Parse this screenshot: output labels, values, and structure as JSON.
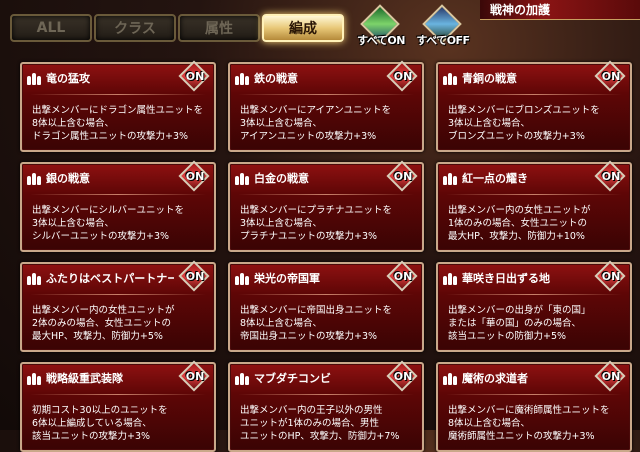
{
  "tabs": [
    {
      "label": "ALL",
      "active": false
    },
    {
      "label": "クラス",
      "active": false
    },
    {
      "label": "属性",
      "active": false
    },
    {
      "label": "編成",
      "active": true
    }
  ],
  "toggles": {
    "all_on": "すべてON",
    "all_off": "すべてOFF"
  },
  "banner": {
    "title": "戦神の加護"
  },
  "badge_label": "ON",
  "cards": [
    {
      "title": "竜の猛攻",
      "desc": "出撃メンバーにドラゴン属性ユニットを\n8体以上含む場合、\nドラゴン属性ユニットの攻撃力+3%"
    },
    {
      "title": "鉄の戦意",
      "desc": "出撃メンバーにアイアンユニットを\n3体以上含む場合、\nアイアンユニットの攻撃力+3%"
    },
    {
      "title": "青銅の戦意",
      "desc": "出撃メンバーにブロンズユニットを\n3体以上含む場合、\nブロンズユニットの攻撃力+3%"
    },
    {
      "title": "銀の戦意",
      "desc": "出撃メンバーにシルバーユニットを\n3体以上含む場合、\nシルバーユニットの攻撃力+3%"
    },
    {
      "title": "白金の戦意",
      "desc": "出撃メンバーにプラチナユニットを\n3体以上含む場合、\nプラチナユニットの攻撃力+3%"
    },
    {
      "title": "紅一点の耀き",
      "desc": "出撃メンバー内の女性ユニットが\n1体のみの場合、女性ユニットの\n最大HP、攻撃力、防御力+10%"
    },
    {
      "title": "ふたりはベストパートナー",
      "desc": "出撃メンバー内の女性ユニットが\n2体のみの場合、女性ユニットの\n最大HP、攻撃力、防御力+5%"
    },
    {
      "title": "栄光の帝国軍",
      "desc": "出撃メンバーに帝国出身ユニットを\n8体以上含む場合、\n帝国出身ユニットの攻撃力+3%"
    },
    {
      "title": "華咲き日出ずる地",
      "desc": "出撃メンバーの出身が「東の国」\nまたは「華の国」のみの場合、\n該当ユニットの防御力+5%"
    },
    {
      "title": "戦略級重武装隊",
      "desc": "初期コスト30以上のユニットを\n6体以上編成している場合、\n該当ユニットの攻撃力+3%"
    },
    {
      "title": "マブダチコンビ",
      "desc": "出撃メンバー内の王子以外の男性\nユニットが1体のみの場合、男性\nユニットのHP、攻撃力、防御力+7%"
    },
    {
      "title": "魔術の求道者",
      "desc": "出撃メンバーに魔術師属性ユニットを\n8体以上含む場合、\n魔術師属性ユニットの攻撃力+3%"
    }
  ]
}
